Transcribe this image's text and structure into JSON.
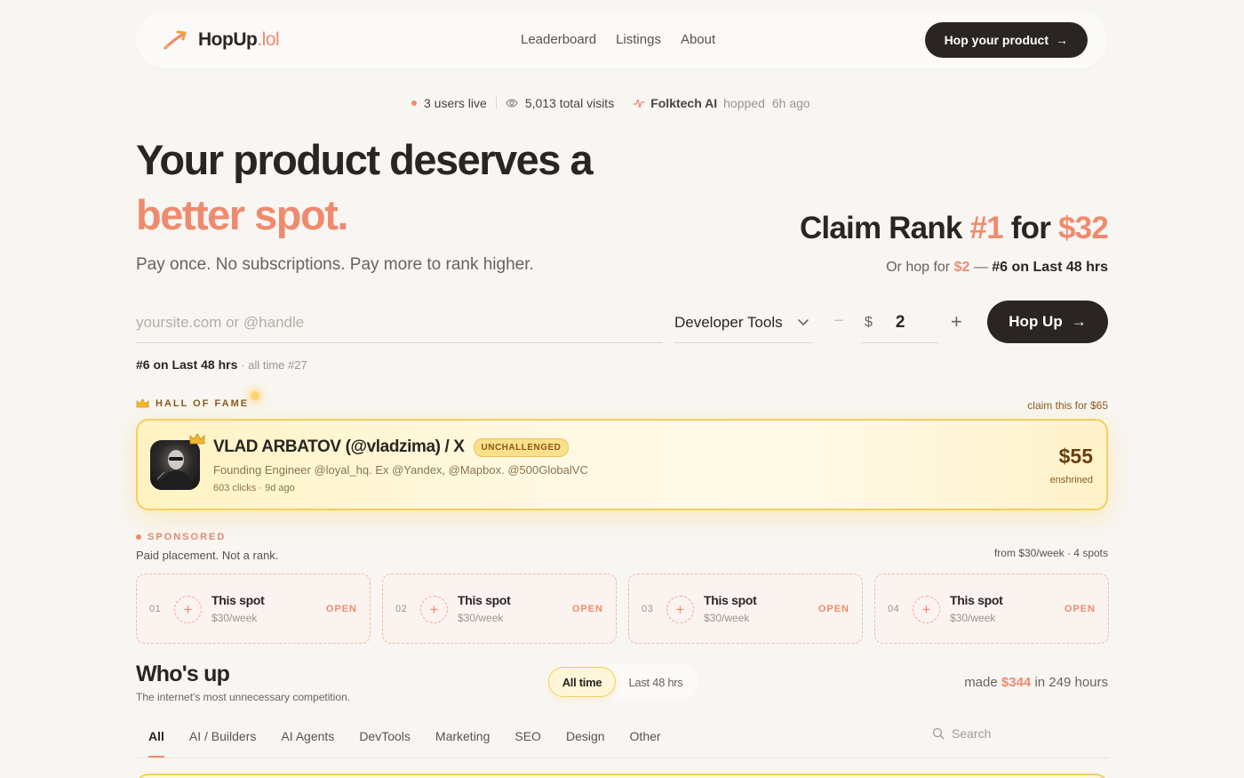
{
  "nav": {
    "logo_name": "HopUp",
    "logo_tld": ".lol",
    "links": [
      "Leaderboard",
      "Listings",
      "About"
    ],
    "cta": "Hop your product"
  },
  "status": {
    "users_live": "3 users live",
    "visits": "5,013 total visits",
    "recent_name": "Folktech AI",
    "recent_action": "hopped",
    "recent_time": "6h ago"
  },
  "hero": {
    "title_line1": "Your product deserves a",
    "title_line2": "better spot.",
    "subtitle": "Pay once. No subscriptions. Pay more to rank higher."
  },
  "claim": {
    "prefix": "Claim Rank",
    "rank": "#1",
    "mid": "for",
    "price": "$32",
    "sub_prefix": "Or hop for",
    "sub_price": "$2",
    "sub_dash": "—",
    "sub_rank": "#6 on Last 48 hrs"
  },
  "form": {
    "url_placeholder": "yoursite.com or @handle",
    "category": "Developer Tools",
    "minus": "−",
    "currency": "$",
    "amount": "2",
    "plus": "+",
    "submit": "Hop Up",
    "rank_note": "#6 on Last 48 hrs",
    "rank_note_sub": "· all time #27"
  },
  "hall_of_fame": {
    "label": "HALL OF FAME",
    "claim_note": "claim this for $65",
    "name": "VLAD ARBATOV (@vladzima) / X",
    "badge": "UNCHALLENGED",
    "bio": "Founding Engineer @loyal_hq. Ex @Yandex, @Mapbox. @500GlobalVC",
    "meta": "603 clicks · 9d ago",
    "price": "$55",
    "price_sub": "enshrined"
  },
  "sponsored": {
    "label": "SPONSORED",
    "sub": "Paid placement. Not a rank.",
    "pricing": "from $30/week · 4 spots",
    "spots": [
      {
        "num": "01",
        "title": "This spot",
        "price": "$30/week",
        "status": "OPEN"
      },
      {
        "num": "02",
        "title": "This spot",
        "price": "$30/week",
        "status": "OPEN"
      },
      {
        "num": "03",
        "title": "This spot",
        "price": "$30/week",
        "status": "OPEN"
      },
      {
        "num": "04",
        "title": "This spot",
        "price": "$30/week",
        "status": "OPEN"
      }
    ]
  },
  "leaderboard": {
    "title": "Who's up",
    "subtitle": "The internet's most unnecessary competition.",
    "toggle_active": "All time",
    "toggle_other": "Last 48 hrs",
    "made_prefix": "made",
    "made_amount": "$344",
    "made_suffix": "in 249 hours",
    "categories": [
      "All",
      "AI / Builders",
      "AI Agents",
      "DevTools",
      "Marketing",
      "SEO",
      "Design",
      "Other"
    ],
    "search_placeholder": "Search"
  },
  "colors": {
    "accent": "#f08a6e",
    "dark": "#2a2522",
    "gold": "#f2cf5e",
    "background": "#f8f6f3"
  }
}
